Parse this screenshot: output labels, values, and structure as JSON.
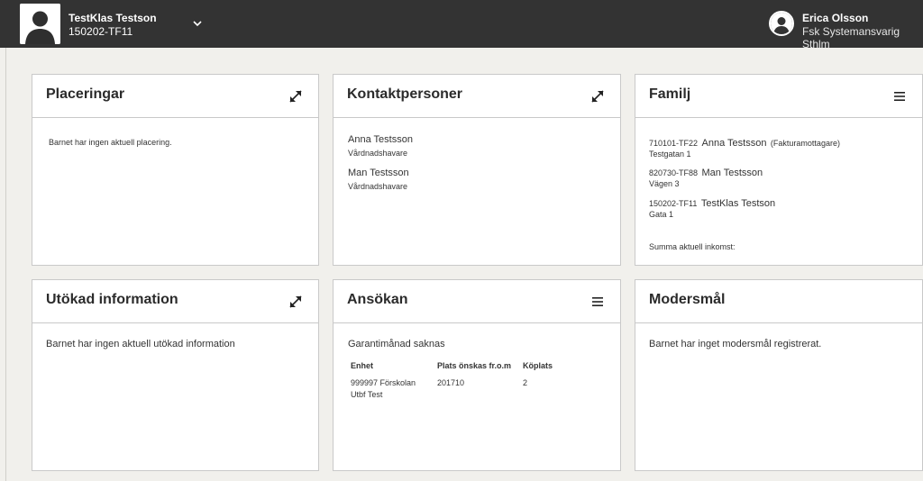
{
  "header": {
    "child_name": "TestKlas Testson",
    "child_id": "150202-TF11",
    "child_photo_icon": "user-silhouette-icon",
    "dropdown_icon": "chevron-down-icon",
    "user_name": "Erica Olsson",
    "user_role": "Fsk Systemansvarig Sthlm",
    "user_avatar_icon": "user-avatar-icon"
  },
  "cards": {
    "placeringar": {
      "title": "Placeringar",
      "action_icon": "expand-icon",
      "text": "Barnet har ingen aktuell placering."
    },
    "kontaktpersoner": {
      "title": "Kontaktpersoner",
      "action_icon": "expand-icon",
      "contacts": [
        {
          "name": "Anna Testsson",
          "role": "Vårdnadshavare"
        },
        {
          "name": "Man Testsson",
          "role": "Vårdnadshavare"
        }
      ]
    },
    "familj": {
      "title": "Familj",
      "action_icon": "menu-icon",
      "members": [
        {
          "id": "710101-TF22",
          "name": "Anna Testsson",
          "note": "Fakturamottagare",
          "address": "Testgatan 1"
        },
        {
          "id": "820730-TF88",
          "name": "Man Testsson",
          "note": "",
          "address": "Vägen 3"
        },
        {
          "id": "150202-TF11",
          "name": "TestKlas Testson",
          "note": "",
          "address": "Gata 1"
        }
      ],
      "income_label": "Summa aktuell inkomst:"
    },
    "utokad": {
      "title": "Utökad information",
      "action_icon": "expand-icon",
      "text": "Barnet har ingen aktuell utökad information"
    },
    "ansokan": {
      "title": "Ansökan",
      "action_icon": "menu-icon",
      "status": "Garantimånad saknas",
      "columns": [
        "Enhet",
        "Plats önskas fr.o.m",
        "Köplats"
      ],
      "rows": [
        {
          "enhet_line1": "999997 Förskolan",
          "enhet_line2": "Utbf Test",
          "from": "201710",
          "koplats": "2"
        }
      ]
    },
    "modersmal": {
      "title": "Modersmål",
      "text": "Barnet har inget modersmål registrerat."
    }
  }
}
